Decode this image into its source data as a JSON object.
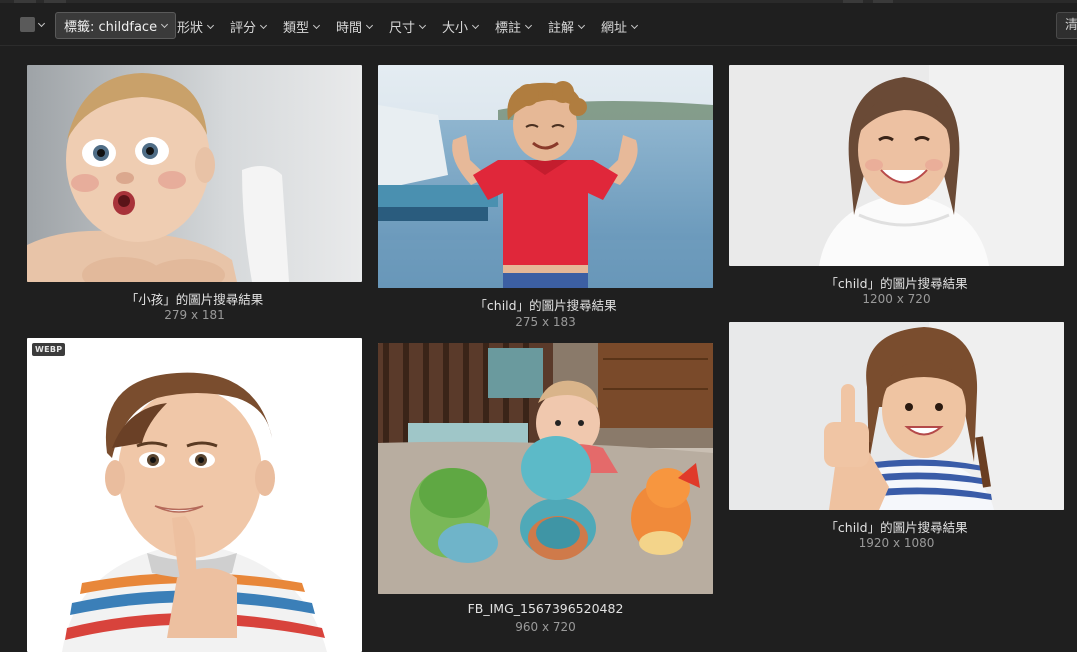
{
  "toolbar": {
    "tag_chip": "標籤: childface",
    "filters": [
      "形狀",
      "評分",
      "類型",
      "時間",
      "尺寸",
      "大小",
      "標註",
      "註解",
      "網址"
    ],
    "clear_label": "清"
  },
  "results": [
    {
      "caption": "「小孩」的圖片搜尋結果",
      "dims": "279 x 181",
      "alt": "Baby with surprised face"
    },
    {
      "caption": "「child」的圖片搜尋結果",
      "dims": "275 x 183",
      "alt": "Curly-haired boy flexing arms by a lake"
    },
    {
      "caption": "「child」的圖片搜尋結果",
      "dims": "1200 x 720",
      "alt": "Smiling girl in white dress"
    },
    {
      "badge": "WEBP",
      "alt": "Boy in striped shirt with finger on chin"
    },
    {
      "caption": "FB_IMG_1567396520482",
      "dims": "960 x 720",
      "alt": "Baby crawling behind plush toys"
    },
    {
      "caption": "「child」的圖片搜尋結果",
      "dims": "1920 x 1080",
      "alt": "Girl giving thumbs up"
    }
  ],
  "colors": {
    "background": "#1f1f1f",
    "chip_bg": "#3a3a3a",
    "caption": "#e2e2e2",
    "dims": "#9a9a9a"
  }
}
